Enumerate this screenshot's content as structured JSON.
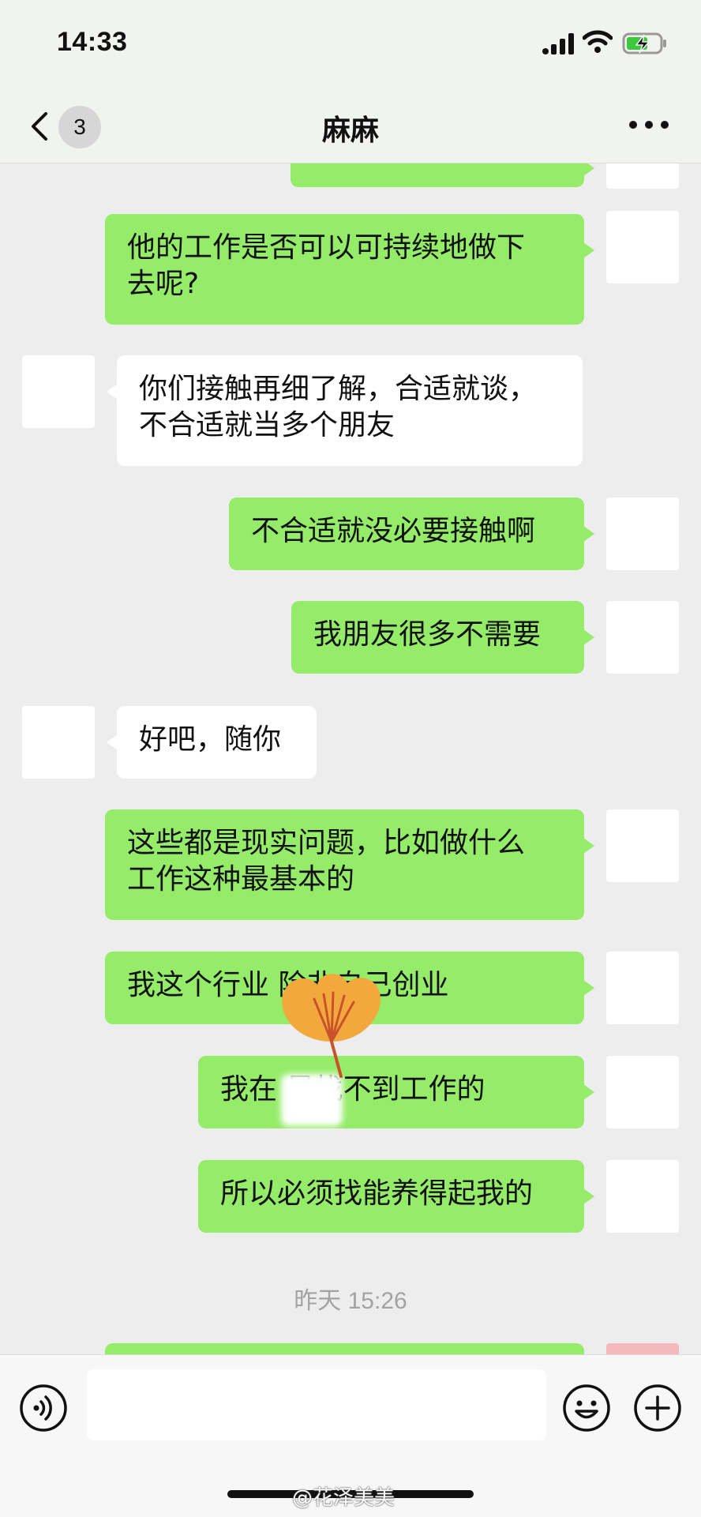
{
  "status_bar": {
    "time": "14:33"
  },
  "nav": {
    "unread_count": "3",
    "title": "麻麻"
  },
  "messages": [
    {
      "side": "out",
      "text": "他的工作是否可以可持续地做下\n去呢?"
    },
    {
      "side": "in",
      "text": "你们接触再细了解，合适就谈，\n不合适就当多个朋友"
    },
    {
      "side": "out",
      "text": "不合适就没必要接触啊"
    },
    {
      "side": "out",
      "text": "我朋友很多不需要"
    },
    {
      "side": "in",
      "text": "好吧，随你"
    },
    {
      "side": "out",
      "text": "这些都是现实问题，比如做什么\n工作这种最基本的"
    },
    {
      "side": "out",
      "text": "我这个行业          除非自己创业"
    },
    {
      "side": "out",
      "text": "我在        是找不到工作的"
    },
    {
      "side": "out",
      "text": "所以必须找能养得起我的"
    }
  ],
  "timestamp": "昨天 15:26",
  "input": {
    "value": "",
    "placeholder": ""
  },
  "watermark": "@花泽美美",
  "colors": {
    "outgoing_bubble": "#95ec69",
    "incoming_bubble": "#ffffff",
    "background": "#ededed"
  }
}
